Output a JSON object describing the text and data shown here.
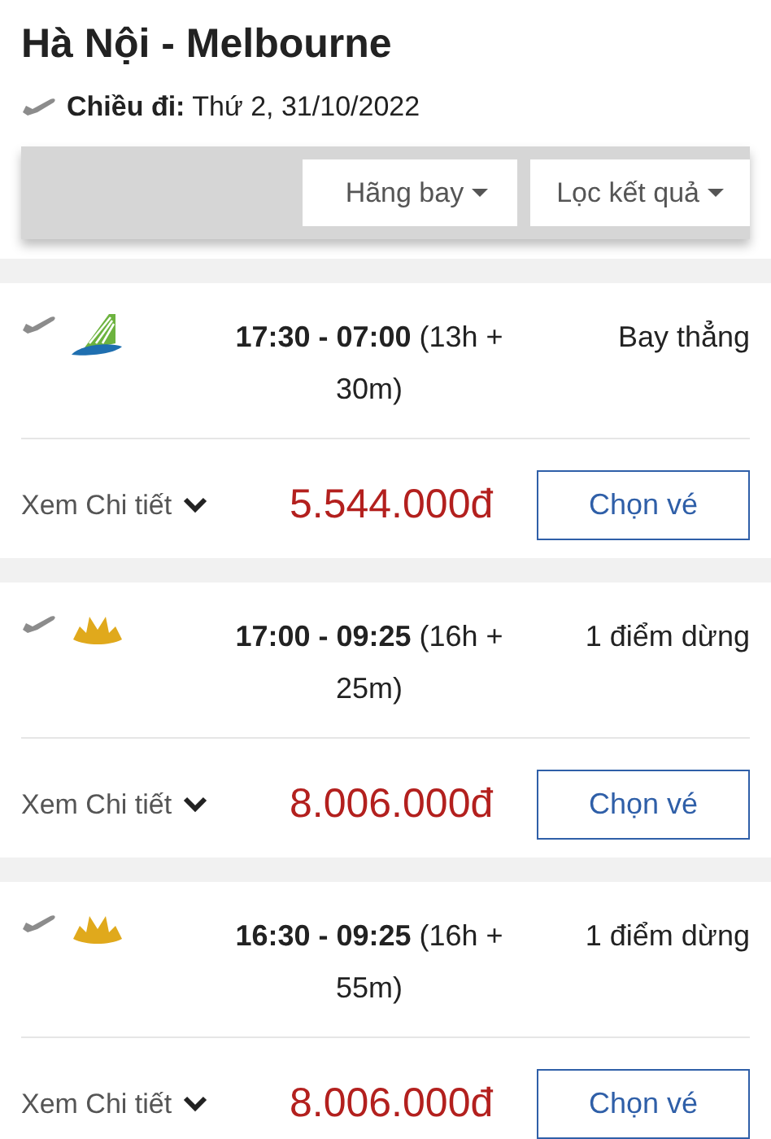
{
  "header": {
    "title": "Hà Nội - Melbourne",
    "trip": "**Chiều đi:** Thứ 2, 31/10/2022"
  },
  "filters": [
    "Hãng bay",
    "Lọc kết quả"
  ],
  "flights": [
    {
      "kind": "leaf",
      "times": "**17:30 - 07:00** (13h + 30m)",
      "stops": "Bay thẳng",
      "details": "Xem Chi tiết",
      "price": "5.544.000đ",
      "action": "Chọn vé"
    },
    {
      "kind": "lotus",
      "times": "**17:00 - 09:25** (16h + 25m)",
      "stops": "1 điểm dừng",
      "details": "Xem Chi tiết",
      "price": "8.006.000đ",
      "action": "Chọn vé"
    },
    {
      "kind": "lotus",
      "times": "**16:30 - 09:25** (16h + 55m)",
      "stops": "1 điểm dừng",
      "details": "Xem Chi tiết",
      "price": "8.006.000đ",
      "action": "Chọn vé"
    }
  ]
}
